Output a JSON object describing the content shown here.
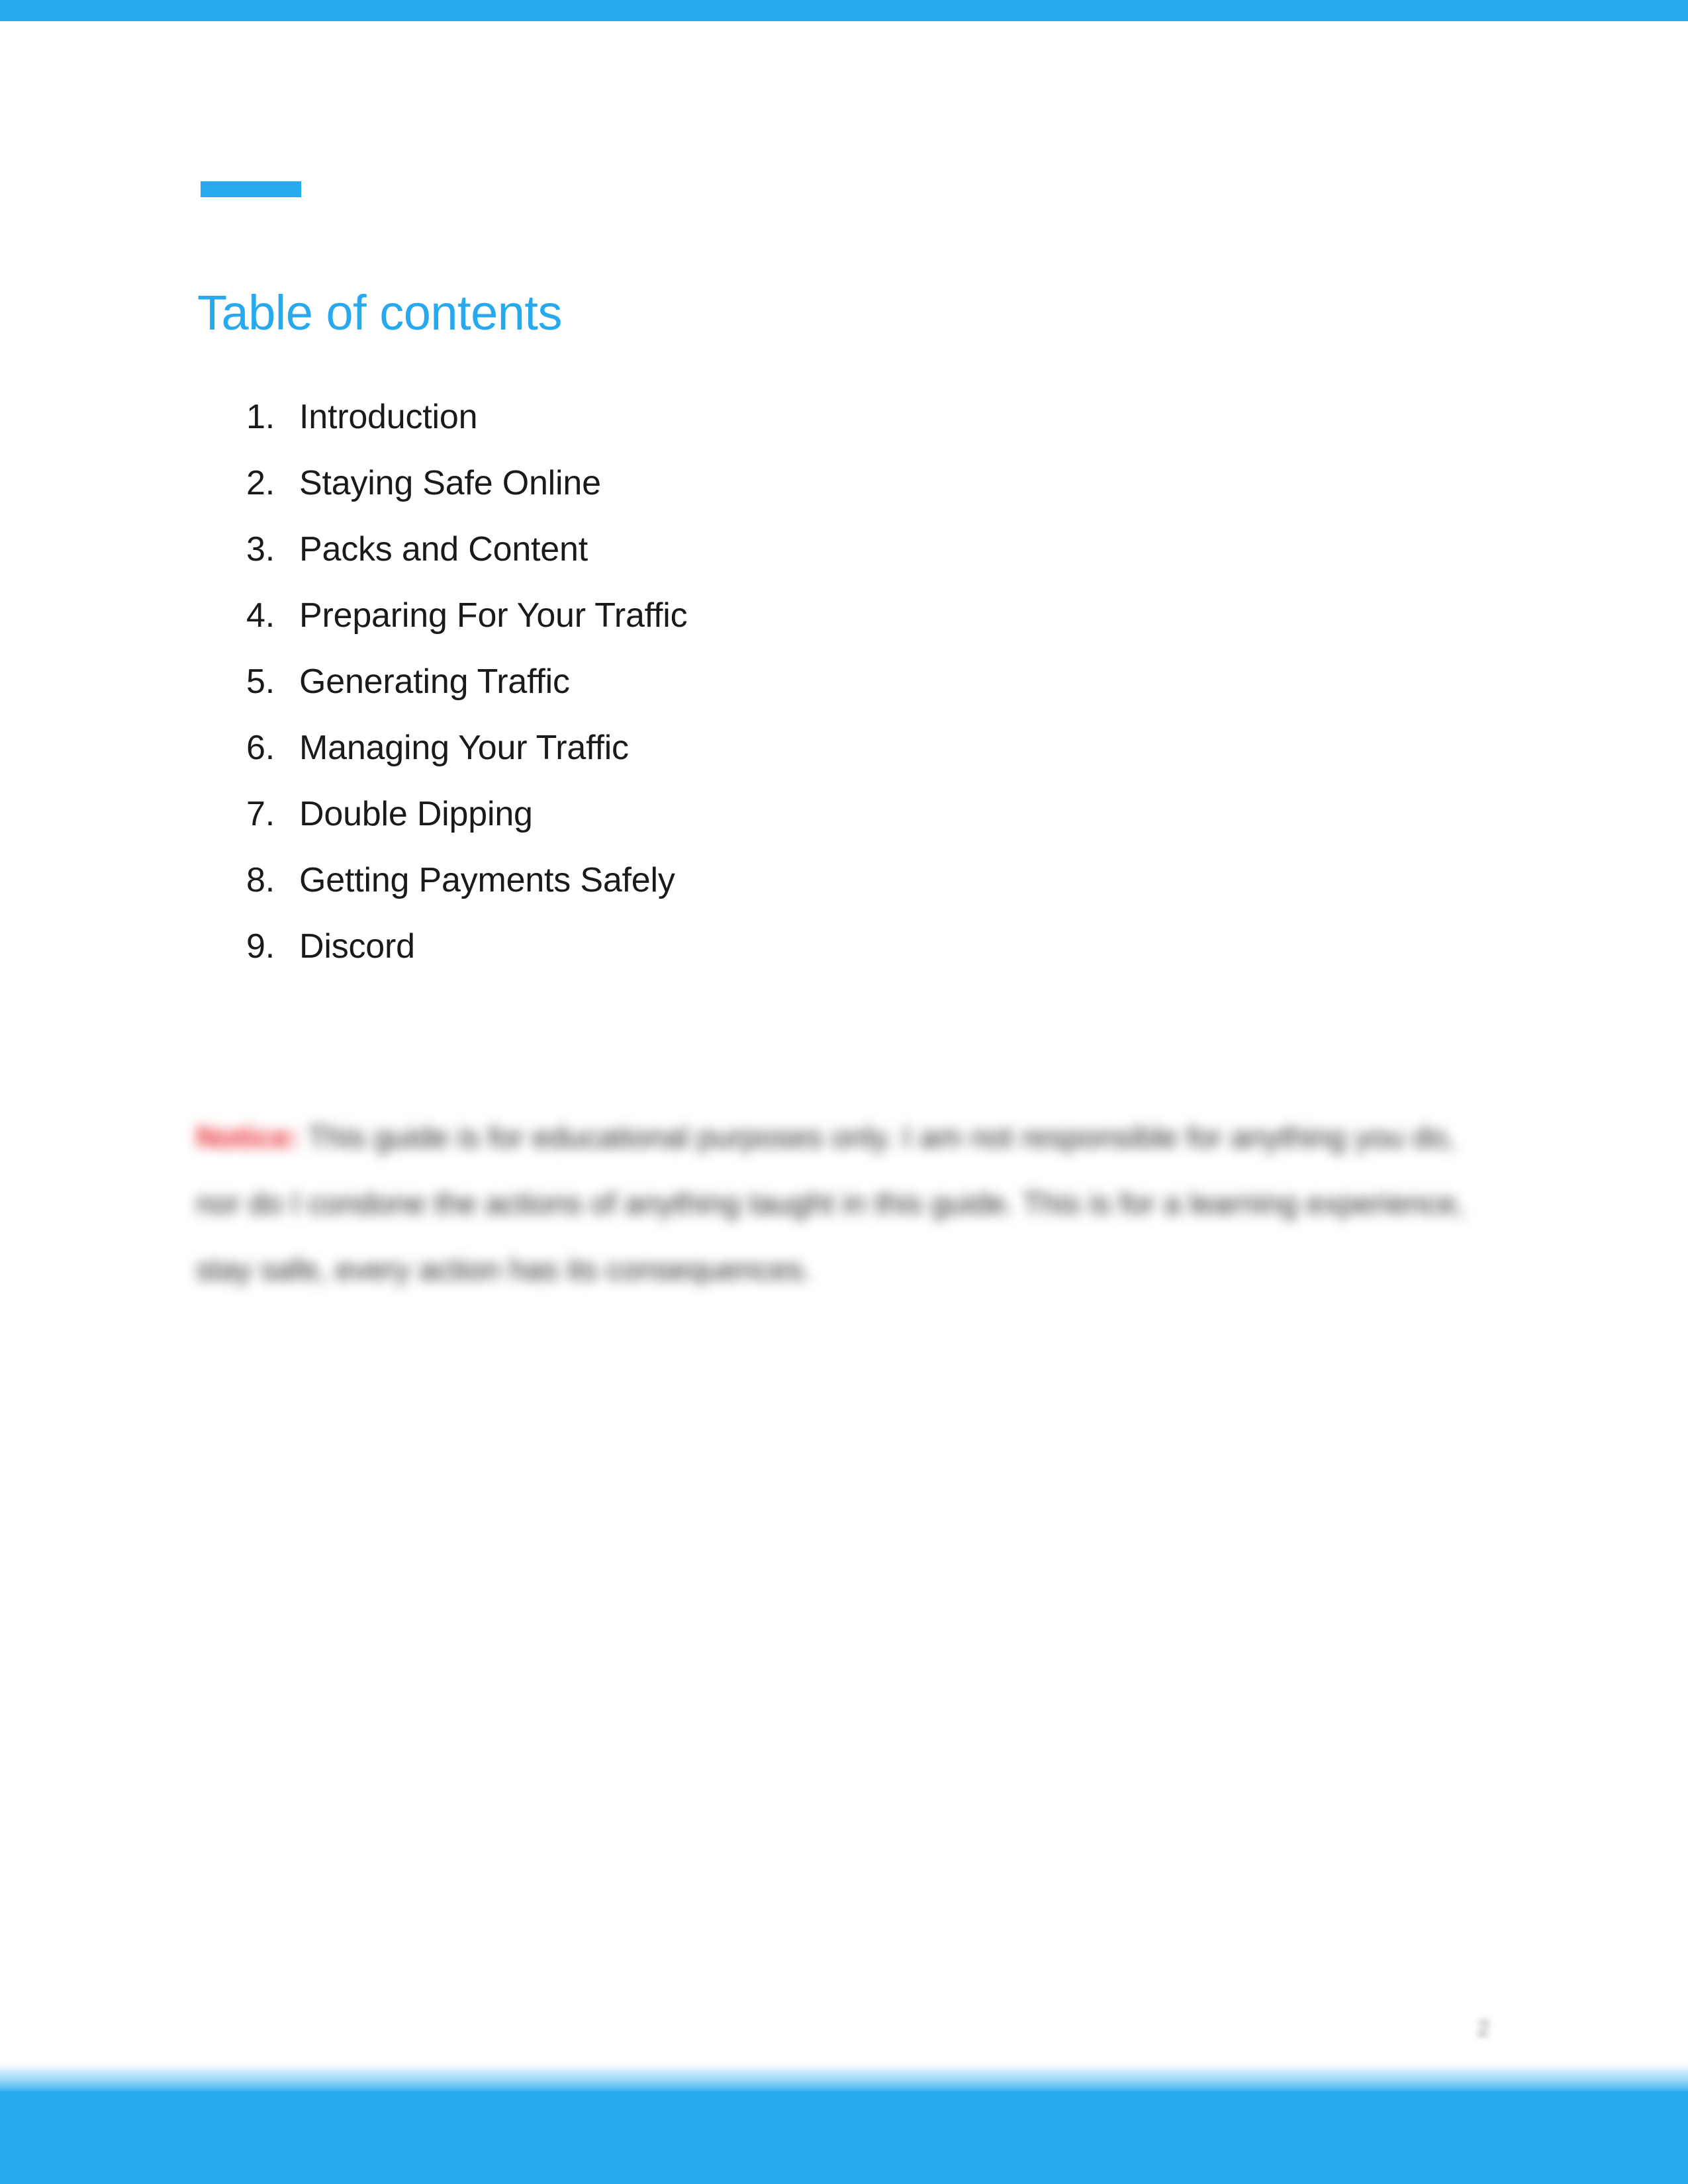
{
  "document": {
    "title": "Table of contents",
    "page_number": "2"
  },
  "theme": {
    "accent_color": "#26a9ef",
    "heading_color": "#26a9ef",
    "body_text_color": "#1a1a1a",
    "notice_label_color": "#e8262d",
    "page_background": "#ffffff"
  },
  "header": {
    "accent_dash_label": "accent-dash"
  },
  "toc": {
    "heading": "Table of contents",
    "items": [
      {
        "number": "1.",
        "label": "Introduction"
      },
      {
        "number": "2.",
        "label": "Staying Safe Online"
      },
      {
        "number": "3.",
        "label": "Packs and Content"
      },
      {
        "number": "4.",
        "label": "Preparing For Your Traffic"
      },
      {
        "number": "5.",
        "label": "Generating Traffic"
      },
      {
        "number": "6.",
        "label": "Managing Your Traffic"
      },
      {
        "number": "7.",
        "label": "Double Dipping"
      },
      {
        "number": "8.",
        "label": "Getting Payments Safely"
      },
      {
        "number": "9.",
        "label": "Discord"
      }
    ]
  },
  "notice": {
    "label": "Notice:",
    "body": " This guide is for educational purposes only. I am not responsible for anything you do, nor do I condone the actions of anything taught in this guide. This is for a learning experience, stay safe, every action has its consequences."
  }
}
